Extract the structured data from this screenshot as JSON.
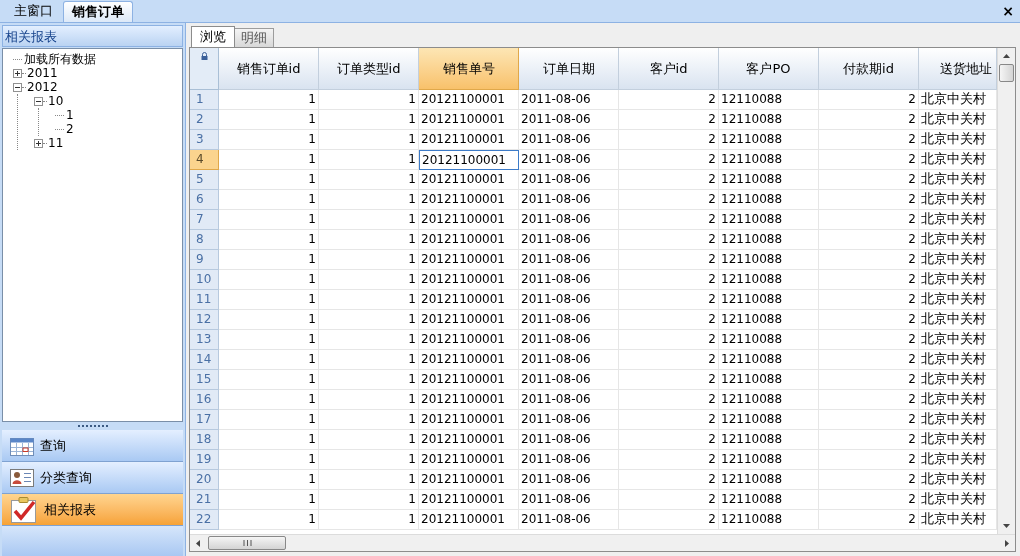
{
  "doc_tabs": [
    {
      "label": "主窗口",
      "selected": false
    },
    {
      "label": "销售订单",
      "selected": true
    }
  ],
  "close_label": "×",
  "sidebar": {
    "title": "相关报表",
    "tree": [
      {
        "label": "加载所有数据"
      },
      {
        "label": "2011",
        "expanded": false
      },
      {
        "label": "2012",
        "expanded": true,
        "children": [
          {
            "label": "10",
            "expanded": true,
            "children": [
              {
                "label": "1"
              },
              {
                "label": "2"
              }
            ]
          },
          {
            "label": "11",
            "expanded": false
          }
        ]
      }
    ],
    "nav": [
      {
        "label": "查询",
        "kind": "calendar",
        "selected": false
      },
      {
        "label": "分类查询",
        "kind": "contact",
        "selected": false
      },
      {
        "label": "相关报表",
        "kind": "checklist",
        "selected": true
      }
    ]
  },
  "view_tabs": [
    {
      "label": "浏览",
      "selected": true
    },
    {
      "label": "明细",
      "selected": false
    }
  ],
  "table": {
    "columns": [
      {
        "label": "销售订单id",
        "numeric": true,
        "selected": false
      },
      {
        "label": "订单类型id",
        "numeric": true,
        "selected": false
      },
      {
        "label": "销售单号",
        "numeric": false,
        "selected": true
      },
      {
        "label": "订单日期",
        "numeric": false,
        "selected": false
      },
      {
        "label": "客户id",
        "numeric": true,
        "selected": false
      },
      {
        "label": "客户PO",
        "numeric": false,
        "selected": false
      },
      {
        "label": "付款期id",
        "numeric": true,
        "selected": false
      },
      {
        "label": "送货地址",
        "numeric": false,
        "selected": false
      }
    ],
    "rows": [
      {
        "n": "1",
        "selected": false,
        "cells": [
          "1",
          "1",
          "20121100001",
          "2011-08-06",
          "2",
          "12110088",
          "2",
          "北京中关村"
        ]
      },
      {
        "n": "2",
        "selected": false,
        "cells": [
          "1",
          "1",
          "20121100001",
          "2011-08-06",
          "2",
          "12110088",
          "2",
          "北京中关村"
        ]
      },
      {
        "n": "3",
        "selected": false,
        "cells": [
          "1",
          "1",
          "20121100001",
          "2011-08-06",
          "2",
          "12110088",
          "2",
          "北京中关村"
        ]
      },
      {
        "n": "4",
        "selected": true,
        "cells": [
          "1",
          "1",
          "20121100001",
          "2011-08-06",
          "2",
          "12110088",
          "2",
          "北京中关村"
        ]
      },
      {
        "n": "5",
        "selected": false,
        "cells": [
          "1",
          "1",
          "20121100001",
          "2011-08-06",
          "2",
          "12110088",
          "2",
          "北京中关村"
        ]
      },
      {
        "n": "6",
        "selected": false,
        "cells": [
          "1",
          "1",
          "20121100001",
          "2011-08-06",
          "2",
          "12110088",
          "2",
          "北京中关村"
        ]
      },
      {
        "n": "7",
        "selected": false,
        "cells": [
          "1",
          "1",
          "20121100001",
          "2011-08-06",
          "2",
          "12110088",
          "2",
          "北京中关村"
        ]
      },
      {
        "n": "8",
        "selected": false,
        "cells": [
          "1",
          "1",
          "20121100001",
          "2011-08-06",
          "2",
          "12110088",
          "2",
          "北京中关村"
        ]
      },
      {
        "n": "9",
        "selected": false,
        "cells": [
          "1",
          "1",
          "20121100001",
          "2011-08-06",
          "2",
          "12110088",
          "2",
          "北京中关村"
        ]
      },
      {
        "n": "10",
        "selected": false,
        "cells": [
          "1",
          "1",
          "20121100001",
          "2011-08-06",
          "2",
          "12110088",
          "2",
          "北京中关村"
        ]
      },
      {
        "n": "11",
        "selected": false,
        "cells": [
          "1",
          "1",
          "20121100001",
          "2011-08-06",
          "2",
          "12110088",
          "2",
          "北京中关村"
        ]
      },
      {
        "n": "12",
        "selected": false,
        "cells": [
          "1",
          "1",
          "20121100001",
          "2011-08-06",
          "2",
          "12110088",
          "2",
          "北京中关村"
        ]
      },
      {
        "n": "13",
        "selected": false,
        "cells": [
          "1",
          "1",
          "20121100001",
          "2011-08-06",
          "2",
          "12110088",
          "2",
          "北京中关村"
        ]
      },
      {
        "n": "14",
        "selected": false,
        "cells": [
          "1",
          "1",
          "20121100001",
          "2011-08-06",
          "2",
          "12110088",
          "2",
          "北京中关村"
        ]
      },
      {
        "n": "15",
        "selected": false,
        "cells": [
          "1",
          "1",
          "20121100001",
          "2011-08-06",
          "2",
          "12110088",
          "2",
          "北京中关村"
        ]
      },
      {
        "n": "16",
        "selected": false,
        "cells": [
          "1",
          "1",
          "20121100001",
          "2011-08-06",
          "2",
          "12110088",
          "2",
          "北京中关村"
        ]
      },
      {
        "n": "17",
        "selected": false,
        "cells": [
          "1",
          "1",
          "20121100001",
          "2011-08-06",
          "2",
          "12110088",
          "2",
          "北京中关村"
        ]
      },
      {
        "n": "18",
        "selected": false,
        "cells": [
          "1",
          "1",
          "20121100001",
          "2011-08-06",
          "2",
          "12110088",
          "2",
          "北京中关村"
        ]
      },
      {
        "n": "19",
        "selected": false,
        "cells": [
          "1",
          "1",
          "20121100001",
          "2011-08-06",
          "2",
          "12110088",
          "2",
          "北京中关村"
        ]
      },
      {
        "n": "20",
        "selected": false,
        "cells": [
          "1",
          "1",
          "20121100001",
          "2011-08-06",
          "2",
          "12110088",
          "2",
          "北京中关村"
        ]
      },
      {
        "n": "21",
        "selected": false,
        "cells": [
          "1",
          "1",
          "20121100001",
          "2011-08-06",
          "2",
          "12110088",
          "2",
          "北京中关村"
        ]
      },
      {
        "n": "22",
        "selected": false,
        "cells": [
          "1",
          "1",
          "20121100001",
          "2011-08-06",
          "2",
          "12110088",
          "2",
          "北京中关村"
        ]
      }
    ]
  }
}
